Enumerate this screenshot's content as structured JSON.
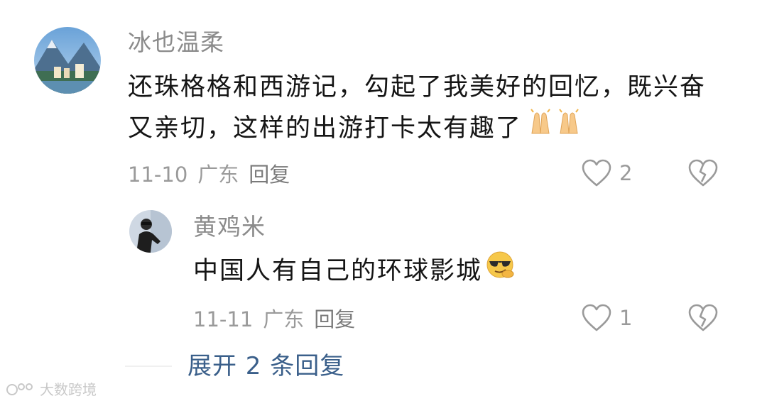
{
  "comment": {
    "username": "冰也温柔",
    "text_line1": "还珠格格和西游记，勾起了我美好的回忆，既兴奋",
    "text_line2": "又亲切，这样的出游打卡太有趣了",
    "date": "11-10",
    "location": "广东",
    "reply_label": "回复",
    "like_count": "2"
  },
  "reply": {
    "username": "黄鸡米",
    "text": "中国人有自己的环球影城",
    "date": "11-11",
    "location": "广东",
    "reply_label": "回复",
    "like_count": "1"
  },
  "expand_label": "展开 2 条回复",
  "watermark": "大数跨境",
  "icons": {
    "like": "heart-outline-icon",
    "dislike": "broken-heart-icon",
    "emoji1": "folded-hands-emoji",
    "emoji2": "sunglasses-smirk-emoji"
  },
  "colors": {
    "username": "#8b8b8b",
    "expand": "#3a5f8a"
  }
}
